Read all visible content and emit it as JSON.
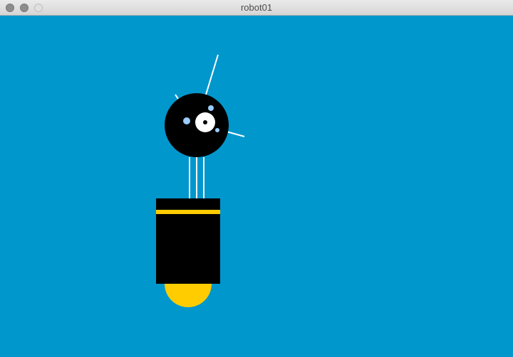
{
  "window": {
    "title": "robot01"
  },
  "canvas": {
    "background_color": "#0097cd"
  },
  "colors": {
    "robot_body": "#000000",
    "stripe": "#ffcc00",
    "base": "#ffcc00",
    "eye": "#ffffff",
    "pupil": "#000000",
    "spots": "#99ccff",
    "lines": "#ffffff"
  }
}
